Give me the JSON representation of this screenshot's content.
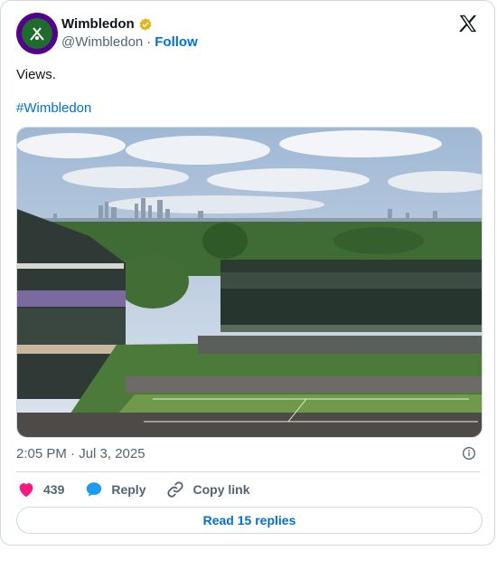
{
  "author": {
    "display_name": "Wimbledon",
    "handle": "@Wimbledon",
    "separator": "·",
    "follow_label": "Follow"
  },
  "tweet": {
    "text": "Views.",
    "hashtag": "#Wimbledon",
    "timestamp": "2:05 PM · Jul 3, 2025"
  },
  "actions": {
    "like_count": "439",
    "reply_label": "Reply",
    "copy_link_label": "Copy link"
  },
  "read_replies_label": "Read 15 replies",
  "colors": {
    "link_blue": "#006fd6",
    "like_pink": "#f91880",
    "reply_blue": "#1d9bf0",
    "verified_gold": "#e2b719",
    "brand_purple": "#54008b",
    "brand_green": "#1f6b2c"
  },
  "icons": [
    "x-logo-icon",
    "verified-badge-icon",
    "info-icon",
    "heart-icon",
    "reply-bubble-icon",
    "link-icon"
  ]
}
